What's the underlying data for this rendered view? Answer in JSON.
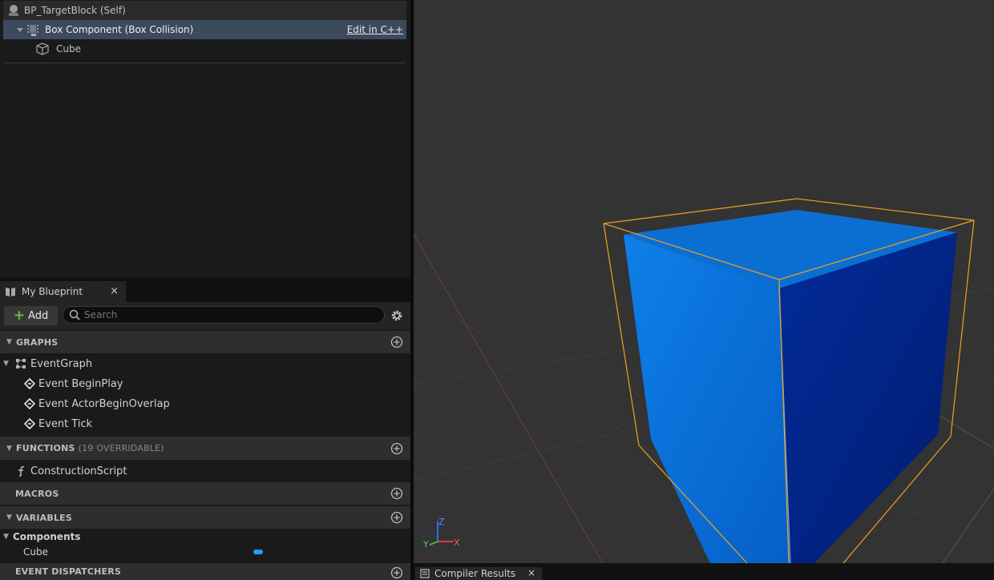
{
  "components": {
    "self_label": "BP_TargetBlock (Self)",
    "box_label": "Box Component (Box Collision)",
    "box_action": "Edit in C++",
    "cube_label": "Cube"
  },
  "my_blueprint": {
    "tab_label": "My Blueprint",
    "close_glyph": "×",
    "add_label": "Add",
    "search_placeholder": "Search",
    "sections": {
      "graphs": "GRAPHS",
      "functions": "FUNCTIONS",
      "functions_sub": "(19 OVERRIDABLE)",
      "macros": "MACROS",
      "variables": "VARIABLES",
      "event_dispatchers": "EVENT DISPATCHERS"
    },
    "graphs": {
      "event_graph": "EventGraph",
      "events": [
        "Event BeginPlay",
        "Event ActorBeginOverlap",
        "Event Tick"
      ]
    },
    "functions": [
      "ConstructionScript"
    ],
    "variables": {
      "category": "Components",
      "items": [
        {
          "name": "Cube",
          "type_color": "#1aa3ff"
        }
      ]
    }
  },
  "viewport": {
    "axis_labels": {
      "x": "X",
      "y": "Y",
      "z": "Z"
    },
    "cube_colors": {
      "front": "#0a78e0",
      "side": "#02258a",
      "top": "#0a6ccc",
      "bounds": "#f0a01e"
    }
  },
  "bottom_tabs": {
    "compiler_results": "Compiler Results",
    "close_glyph": "×"
  }
}
